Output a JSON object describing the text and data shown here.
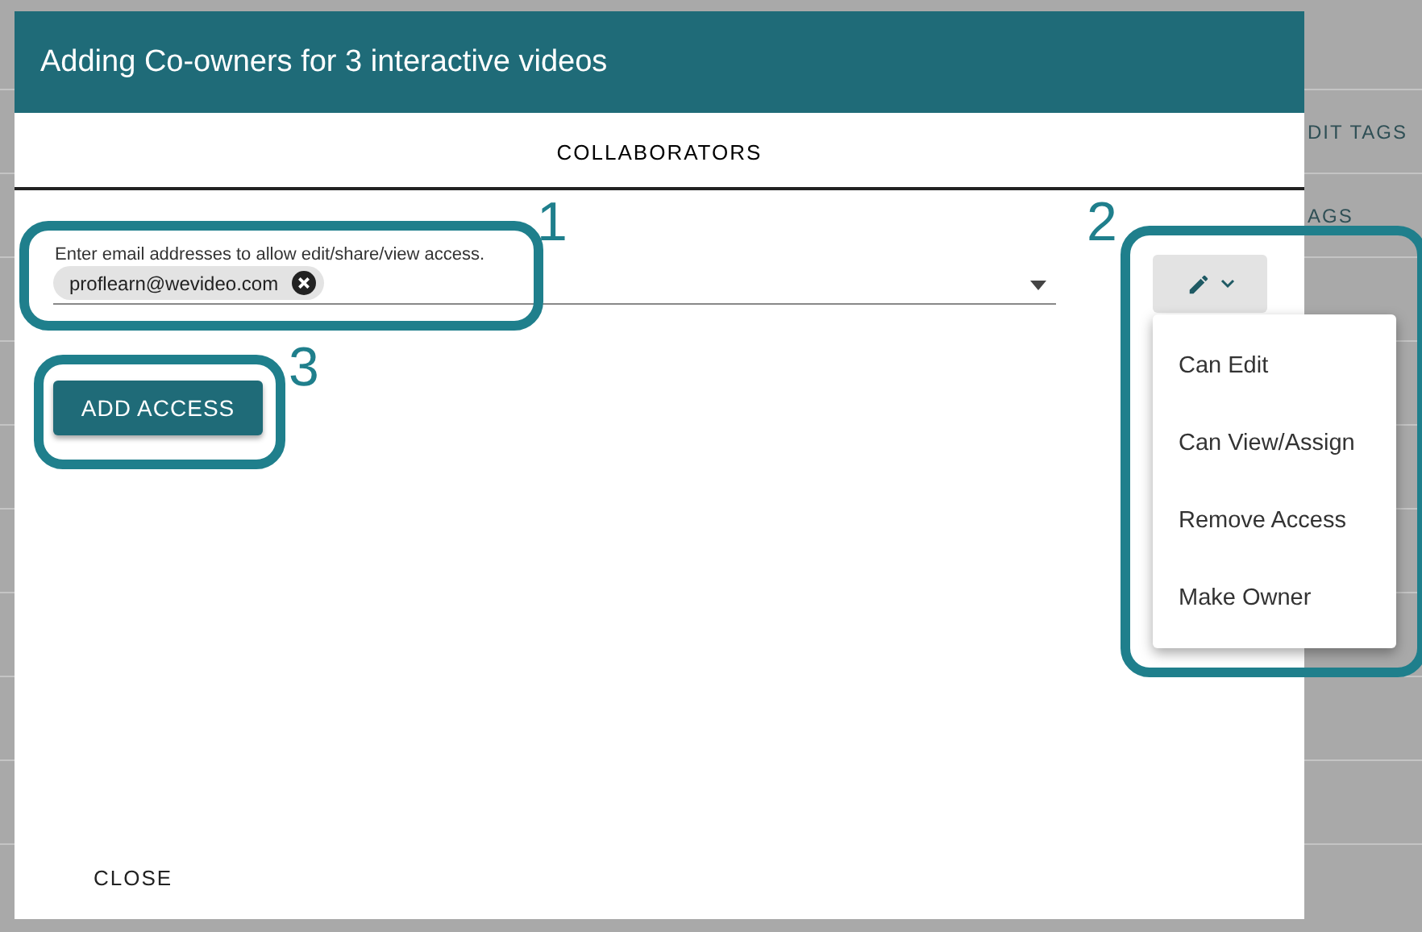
{
  "background": {
    "column_texts": [
      "DIT TAGS",
      "AGS"
    ]
  },
  "dialog": {
    "title": "Adding Co-owners for 3 interactive videos",
    "tabs": [
      {
        "label": "COLLABORATORS",
        "selected": true
      }
    ],
    "email_field": {
      "label": "Enter email addresses to allow edit/share/view access.",
      "chips": [
        "proflearn@wevideo.com"
      ]
    },
    "add_button": "ADD ACCESS",
    "close_button": "CLOSE"
  },
  "permission_menu": {
    "items": [
      "Can Edit",
      "Can View/Assign",
      "Remove Access",
      "Make Owner"
    ]
  },
  "callouts": [
    {
      "number": "1"
    },
    {
      "number": "2"
    },
    {
      "number": "3"
    }
  ]
}
